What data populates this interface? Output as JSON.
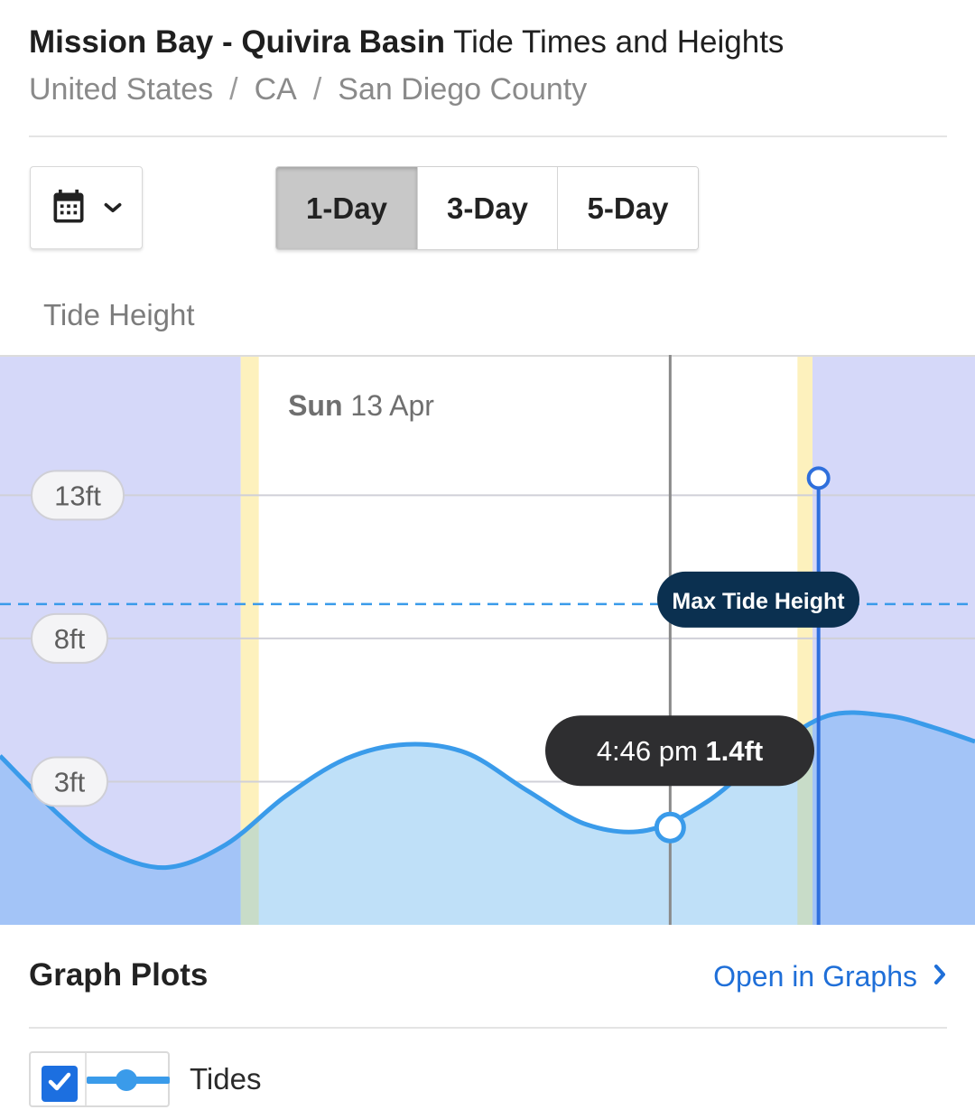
{
  "header": {
    "location_name": "Mission Bay - Quivira Basin",
    "title_suffix": "Tide Times and Heights",
    "breadcrumb": [
      "United States",
      "CA",
      "San Diego County"
    ],
    "breadcrumb_separator": "/"
  },
  "controls": {
    "calendar_icon": "calendar-icon",
    "dropdown_icon": "chevron-down-icon",
    "range_tabs": [
      {
        "label": "1-Day",
        "active": true
      },
      {
        "label": "3-Day",
        "active": false
      },
      {
        "label": "5-Day",
        "active": false
      }
    ]
  },
  "chart_label": "Tide Height",
  "chart_data": {
    "type": "area",
    "title": "Sun 13 Apr",
    "title_day": "Sun",
    "title_date": "13 Apr",
    "ylabel": "Tide Height",
    "y_ticks": [
      {
        "value": 3,
        "label": "3ft"
      },
      {
        "value": 8,
        "label": "8ft"
      },
      {
        "value": 13,
        "label": "13ft"
      }
    ],
    "ylim": [
      -2.0,
      17.9
    ],
    "xlim": [
      -5.5,
      26.9
    ],
    "series": [
      {
        "x": [
          -5.5,
          -3.5,
          -2.0,
          0.0,
          2.0,
          4.0,
          6.0,
          8.0,
          10.0,
          12.0,
          14.0,
          16.0,
          18.0,
          20.0,
          22.0,
          24.0,
          25.5,
          26.9
        ],
        "y": [
          3.9,
          1.8,
          0.6,
          0.0,
          0.8,
          2.5,
          3.8,
          4.3,
          4.0,
          2.7,
          1.5,
          1.3,
          2.3,
          4.0,
          5.3,
          5.3,
          4.9,
          4.4
        ]
      }
    ],
    "night_bands": [
      [
        -5.5,
        2.5
      ],
      [
        21.5,
        26.9
      ]
    ],
    "twilight_bands": [
      [
        2.5,
        3.1
      ],
      [
        21.0,
        21.5
      ]
    ],
    "max_tide_height": 9.2,
    "max_tide_label": "Max Tide Height",
    "current_marker": {
      "x": 16.77,
      "y": 1.4,
      "time": "4:46 pm",
      "value": "1.4ft"
    },
    "highlight_marker": {
      "x": 21.7,
      "y": 13.6
    },
    "grid": true,
    "colors": {
      "line": "#3a9bea",
      "fill_day": "#bfe0f8",
      "fill_night": "#a3c4f7",
      "night": "#d5d8f9",
      "twilight": "#fdf1bd",
      "max_line": "#3a9bea"
    }
  },
  "plots": {
    "title": "Graph Plots",
    "open_link": "Open in Graphs",
    "open_link_icon": "chevron-right-icon",
    "items": [
      {
        "label": "Tides",
        "checked": true,
        "color": "#3a9bea"
      }
    ]
  }
}
